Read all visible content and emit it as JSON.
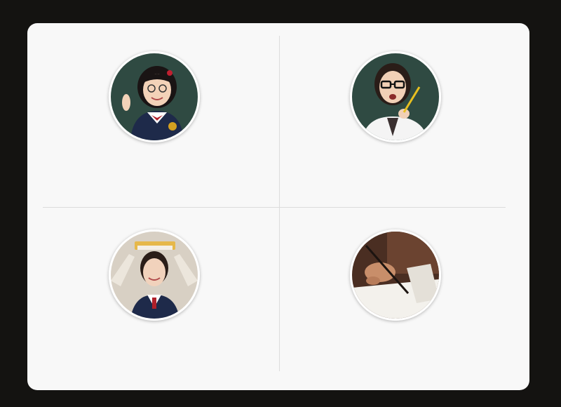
{
  "photos": [
    {
      "icon": "student-girl-waving-photo-icon"
    },
    {
      "icon": "student-girl-glasses-pencil-photo-icon"
    },
    {
      "icon": "student-girl-book-on-head-photo-icon"
    },
    {
      "icon": "hand-writing-pencil-photo-icon"
    }
  ],
  "colors": {
    "frame": "#141311",
    "card": "#f8f8f8",
    "divider": "#dcdcdc",
    "chalkboard": "#2f4a42",
    "uniform_navy": "#1e2a4a"
  }
}
